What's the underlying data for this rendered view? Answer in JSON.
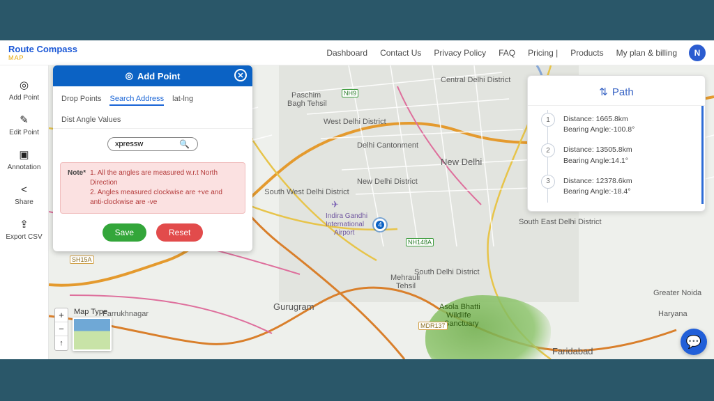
{
  "brand": {
    "name": "Route Compass",
    "sub": "MAP"
  },
  "nav": {
    "links": [
      "Dashboard",
      "Contact Us",
      "Privacy Policy",
      "FAQ",
      "Pricing |",
      "Products",
      "My plan & billing"
    ],
    "avatar_initial": "N"
  },
  "left_tools": [
    {
      "icon": "◎",
      "label": "Add Point",
      "name": "tool-add-point"
    },
    {
      "icon": "✎",
      "label": "Edit Point",
      "name": "tool-edit-point"
    },
    {
      "icon": "▣",
      "label": "Annotation",
      "name": "tool-annotation"
    },
    {
      "icon": "<",
      "label": "Share",
      "name": "tool-share"
    },
    {
      "icon": "⇪",
      "label": "Export CSV",
      "name": "tool-export-csv"
    }
  ],
  "panel": {
    "title": "Add Point",
    "tabs": [
      "Drop Points",
      "Search Address",
      "lat-lng",
      "Dist Angle Values"
    ],
    "active_tab_index": 1,
    "search_value": "xpressw",
    "note_label": "Note*",
    "note_lines": [
      "1. All the angles are measured w.r.t North Direction",
      "2. Angles measured clockwise are +ve and anti-clockwise are -ve"
    ],
    "save_label": "Save",
    "reset_label": "Reset"
  },
  "path": {
    "title": "Path",
    "items": [
      {
        "num": "1",
        "distance": "Distance: 1665.8km",
        "bearing": "Bearing Angle:-100.8°"
      },
      {
        "num": "2",
        "distance": "Distance: 13505.8km",
        "bearing": "Bearing Angle:14.1°"
      },
      {
        "num": "3",
        "distance": "Distance: 12378.6km",
        "bearing": "Bearing Angle:-18.4°"
      }
    ]
  },
  "map": {
    "labels": {
      "new_delhi": "New Delhi",
      "gurugram": "Gurugram",
      "faridabad": "Faridabad",
      "greater_noida": "Greater Noida",
      "haryana": "Haryana",
      "central_delhi": "Central Delhi District",
      "west_delhi": "West Delhi District",
      "sw_delhi": "South West Delhi District",
      "south_delhi": "South Delhi District",
      "se_delhi": "South East Delhi District",
      "farrukhnagar": "Farrukhnagar",
      "cantonment": "Delhi Cantonment",
      "new_delhi_dist": "New Delhi District",
      "airport1": "Indira Gandhi",
      "airport2": "International",
      "airport3": "Airport",
      "paschim": "Paschim",
      "bagh": "Bagh Tehsil",
      "mehrauli1": "Mehrauli",
      "mehrauli2": "Tehsil",
      "asola1": "Asola Bhatti",
      "asola2": "Wildlife",
      "asola3": "Sanctuary"
    },
    "road_badges": {
      "sh15a": "SH15A",
      "nh9": "NH9",
      "nh148a": "NH148A",
      "mdr137": "MDR137"
    },
    "marker_label": "4",
    "maptype_label": "Map Type",
    "zoom_plus": "+",
    "zoom_minus": "−",
    "zoom_reset": "↑"
  }
}
